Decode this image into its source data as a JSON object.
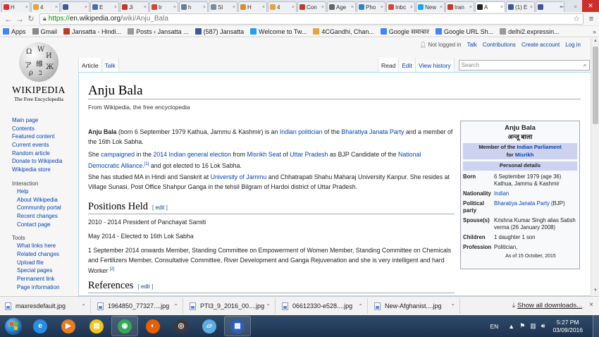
{
  "browser": {
    "tabs": [
      {
        "label": "H",
        "favicon_color": "#d93025"
      },
      {
        "label": "4",
        "favicon_color": "#e8a33d"
      },
      {
        "label": "",
        "favicon_color": "#3b5998"
      },
      {
        "label": "E",
        "favicon_color": "#4a6fa5"
      },
      {
        "label": "Ji",
        "favicon_color": "#c0392b"
      },
      {
        "label": "Ir",
        "favicon_color": "#d44638"
      },
      {
        "label": "h",
        "favicon_color": "#6a7c99"
      },
      {
        "label": "Sl",
        "favicon_color": "#7a8aa0"
      },
      {
        "label": "H",
        "favicon_color": "#e08a2a"
      },
      {
        "label": "4",
        "favicon_color": "#e8a33d"
      },
      {
        "label": "Con",
        "favicon_color": "#c0392b"
      },
      {
        "label": "Age",
        "favicon_color": "#666666"
      },
      {
        "label": "Pho",
        "favicon_color": "#2e86c1"
      },
      {
        "label": "Inbc",
        "favicon_color": "#d44638"
      },
      {
        "label": "New",
        "favicon_color": "#1da1f2"
      },
      {
        "label": "Iran",
        "favicon_color": "#c0392b"
      },
      {
        "label": "A",
        "favicon_color": "#222222",
        "active": true
      },
      {
        "label": "(1) E",
        "favicon_color": "#3b5998"
      },
      {
        "label": "",
        "favicon_color": "#3b5998"
      }
    ],
    "url_scheme": "https://",
    "url_host": "en.wikipedia.org",
    "url_path": "/wiki/Anju_Bala",
    "bookmarks": [
      {
        "label": "Apps",
        "icon": "apps-grid-icon",
        "color": "#4285f4"
      },
      {
        "label": "Gmail",
        "icon": "gmail-icon",
        "color": "#888888"
      },
      {
        "label": "Jansatta - Hindi...",
        "icon": "jansatta-icon",
        "color": "#c0392b"
      },
      {
        "label": "Posts ‹ Jansatta ...",
        "icon": "page-icon",
        "color": "#999999"
      },
      {
        "label": "(587) Jansatta",
        "icon": "facebook-icon",
        "color": "#3b5998"
      },
      {
        "label": "Welcome to Tw...",
        "icon": "twitter-icon",
        "color": "#1da1f2"
      },
      {
        "label": "4CGandhi, Chan...",
        "icon": "folder-icon",
        "color": "#e8a33d"
      },
      {
        "label": "Google समाचार",
        "icon": "google-icon",
        "color": "#4285f4"
      },
      {
        "label": "Google URL Sh...",
        "icon": "google-icon",
        "color": "#4285f4"
      },
      {
        "label": "delhi2.expressin...",
        "icon": "page-icon",
        "color": "#999999"
      }
    ],
    "bookmarks_more": "»"
  },
  "wiki": {
    "wordmark": "WIKIPEDIA",
    "tagline": "The Free Encyclopedia",
    "personal": [
      "Not logged in",
      "Talk",
      "Contributions",
      "Create account",
      "Log in"
    ],
    "left_tabs": [
      "Article",
      "Talk"
    ],
    "right_tabs": [
      "Read",
      "Edit",
      "View history"
    ],
    "search_placeholder": "Search",
    "sidebar_main": [
      "Main page",
      "Contents",
      "Featured content",
      "Current events",
      "Random article",
      "Donate to Wikipedia",
      "Wikipedia store"
    ],
    "interaction_heading": "Interaction",
    "sidebar_interaction": [
      "Help",
      "About Wikipedia",
      "Community portal",
      "Recent changes",
      "Contact page"
    ],
    "tools_heading": "Tools",
    "sidebar_tools": [
      "What links here",
      "Related changes",
      "Upload file",
      "Special pages",
      "Permanent link",
      "Page information"
    ]
  },
  "article": {
    "title": "Anju Bala",
    "from": "From Wikipedia, the free encyclopedia",
    "p1_bold": "Anju Bala",
    "p1_a": " (born 6 September 1979 Kathua, Jammu & Kashmir) is an ",
    "p1_link1": "Indian politician",
    "p1_b": " of the ",
    "p1_link2": "Bharatiya Janata Party",
    "p1_c": " and a member of the 16th Lok Sabha.",
    "p2_a": "She ",
    "p2_link1": "campaigned",
    "p2_b": " in the ",
    "p2_link2": "2014 Indian general election",
    "p2_c": " from ",
    "p2_link3": "Misrikh Seat",
    "p2_d": " of ",
    "p2_link4": "Uttar Pradesh",
    "p2_e": " as BJP Candidate of the ",
    "p2_link5": "National Democratic Alliance.",
    "p2_ref": "[1]",
    "p2_f": " and got elected to 16 Lok Sabha.",
    "p3_a": "She has studied MA in Hindi and Sanskrit at ",
    "p3_link1": "University of Jammu",
    "p3_b": " and Chhatrapati Shahu Maharaj University Kanpur. She resides at Village Sunasi, Post Office Shahpur Ganga in the tehsil Bilgram of Hardoi district of Uttar Pradesh.",
    "h_positions": "Positions Held",
    "edit_open": "[",
    "edit_label": "edit",
    "edit_close": "]",
    "pos1": "2010 - 2014 President of Panchayat Samiti",
    "pos2": "May 2014 - Elected to 16th Lok Sabha",
    "pos3": "1 September 2014 onwards Member, Standing Committee on Empowerment of Women Member, Standing Committee on Chemicals and Fertilizers Member, Consultative Committee, River Development and Ganga Rejuvenation and she is very intelligent and hard Worker ",
    "pos3_ref": "[2]",
    "h_references": "References"
  },
  "infobox": {
    "name": "Anju Bala",
    "name_hindi": "अन्जू बाला",
    "band1_a": "Member of the ",
    "band1_link": "Indian Parliament",
    "band1_b": "for ",
    "band1_link2": "Misrikh",
    "band2": "Personal details",
    "born_k": "Born",
    "born_v": "6 September 1979 (age 36) Kathua, Jammu & Kashmir",
    "nat_k": "Nationality",
    "nat_v": "Indian",
    "party_k": "Political party",
    "party_v_link": "Bharatiya Janata Party",
    "party_v_b": " (BJP)",
    "spouse_k": "Spouse(s)",
    "spouse_v": "Krishna Kumar Singh alias Satish verma (26 January 2008)",
    "children_k": "Children",
    "children_v": "1 daughter 1 son",
    "prof_k": "Profession",
    "prof_v": "Politician,",
    "asof": "As of 15 October, 2015"
  },
  "downloads": {
    "items": [
      "maxresdefault.jpg",
      "1964850_77327....jpg",
      "PTI3_9_2016_00....jpg",
      "06612330-e528....jpg",
      "New-Afghanist....jpg"
    ],
    "show_all": "Show all downloads...",
    "close": "×"
  },
  "taskbar": {
    "apps": [
      {
        "icon": "internet-explorer-icon",
        "color": "#2a8de0",
        "glyph": "e",
        "running": false
      },
      {
        "icon": "media-player-icon",
        "color": "#e67e22",
        "glyph": "▶",
        "running": false
      },
      {
        "icon": "file-explorer-icon",
        "color": "#f0c419",
        "glyph": "▤",
        "running": false
      },
      {
        "icon": "chrome-icon",
        "color": "#34a853",
        "glyph": "◉",
        "running": true
      },
      {
        "icon": "firefox-icon",
        "color": "#e66000",
        "glyph": "◐",
        "running": false
      },
      {
        "icon": "media-center-icon",
        "color": "#3a3a3a",
        "glyph": "◎",
        "running": false
      },
      {
        "icon": "document-icon",
        "color": "#5dade2",
        "glyph": "▱",
        "running": false
      },
      {
        "icon": "calendar-app-icon",
        "color": "#2c5fb8",
        "glyph": "▦",
        "running": true
      }
    ],
    "language": "EN",
    "time": "5:27 PM",
    "date": "03/09/2016"
  }
}
